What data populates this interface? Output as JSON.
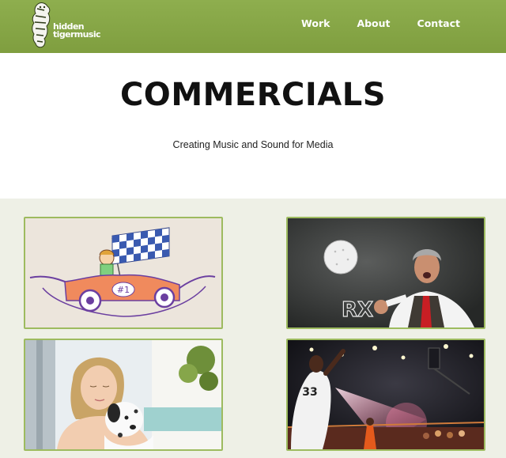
{
  "brand": {
    "logo_line1": "hidden",
    "logo_line2": "tigermusic"
  },
  "nav": {
    "items": [
      {
        "label": "Work"
      },
      {
        "label": "About"
      },
      {
        "label": "Contact"
      }
    ]
  },
  "hero": {
    "title": "COMMERCIALS",
    "subtitle": "Creating Music and Sound for Media"
  },
  "thumbnails": [
    {
      "name": "race-car-cartoon",
      "caption": "#1"
    },
    {
      "name": "golf-ball-man",
      "caption": "RX"
    },
    {
      "name": "woman-with-puppy",
      "caption": ""
    },
    {
      "name": "basketball-player",
      "caption": "33"
    }
  ],
  "colors": {
    "header": "#8eae4e",
    "gallery_bg": "#eef0e6",
    "thumb_border": "#9dbb5f"
  }
}
